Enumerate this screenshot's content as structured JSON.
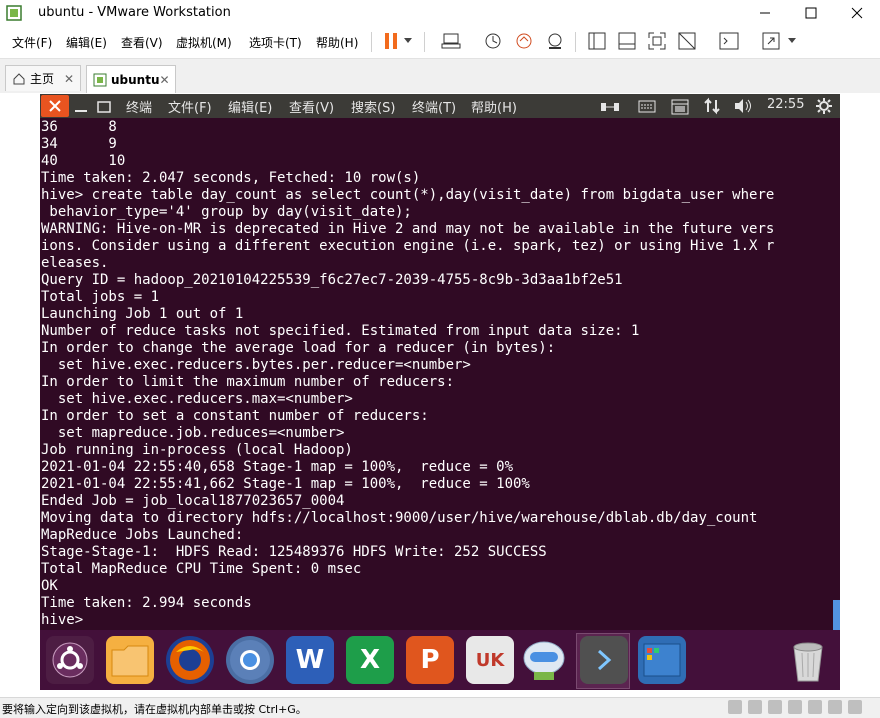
{
  "window": {
    "title": "ubuntu - VMware Workstation"
  },
  "menubar": {
    "items": [
      "文件(F)",
      "编辑(E)",
      "查看(V)",
      "虚拟机(M)",
      "选项卡(T)",
      "帮助(H)"
    ]
  },
  "tabs": [
    {
      "label": "主页",
      "icon": "home-icon",
      "active": false
    },
    {
      "label": "ubuntu",
      "icon": "vm-icon",
      "active": true
    }
  ],
  "ubuntu": {
    "menus": [
      "终端",
      "文件(F)",
      "编辑(E)",
      "查看(V)",
      "搜索(S)",
      "终端(T)",
      "帮助(H)"
    ],
    "clock": "22:55",
    "accent": "#e95420"
  },
  "terminal": {
    "lines": [
      "36      8",
      "34      9",
      "40      10",
      "Time taken: 2.047 seconds, Fetched: 10 row(s)",
      "hive> create table day_count as select count(*),day(visit_date) from bigdata_user where",
      " behavior_type='4' group by day(visit_date);",
      "WARNING: Hive-on-MR is deprecated in Hive 2 and may not be available in the future vers",
      "ions. Consider using a different execution engine (i.e. spark, tez) or using Hive 1.X r",
      "eleases.",
      "Query ID = hadoop_20210104225539_f6c27ec7-2039-4755-8c9b-3d3aa1bf2e51",
      "Total jobs = 1",
      "Launching Job 1 out of 1",
      "Number of reduce tasks not specified. Estimated from input data size: 1",
      "In order to change the average load for a reducer (in bytes):",
      "  set hive.exec.reducers.bytes.per.reducer=<number>",
      "In order to limit the maximum number of reducers:",
      "  set hive.exec.reducers.max=<number>",
      "In order to set a constant number of reducers:",
      "  set mapreduce.job.reduces=<number>",
      "Job running in-process (local Hadoop)",
      "2021-01-04 22:55:40,658 Stage-1 map = 100%,  reduce = 0%",
      "2021-01-04 22:55:41,662 Stage-1 map = 100%,  reduce = 100%",
      "Ended Job = job_local1877023657_0004",
      "Moving data to directory hdfs://localhost:9000/user/hive/warehouse/dblab.db/day_count",
      "MapReduce Jobs Launched:",
      "Stage-Stage-1:  HDFS Read: 125489376 HDFS Write: 252 SUCCESS",
      "Total MapReduce CPU Time Spent: 0 msec",
      "OK",
      "Time taken: 2.994 seconds",
      "hive> "
    ]
  },
  "dock": {
    "items": [
      {
        "name": "ubuntu-logo-icon"
      },
      {
        "name": "files-icon"
      },
      {
        "name": "firefox-icon"
      },
      {
        "name": "chromium-icon"
      },
      {
        "name": "wps-writer-icon",
        "label": "W"
      },
      {
        "name": "wps-spreadsheet-icon",
        "label": "X"
      },
      {
        "name": "wps-presentation-icon",
        "label": "P"
      },
      {
        "name": "software-center-icon",
        "label": "UK"
      },
      {
        "name": "installer-icon"
      },
      {
        "name": "terminal-icon"
      },
      {
        "name": "workspace-icon"
      },
      {
        "name": "trash-icon"
      }
    ]
  },
  "statusbar": {
    "text": "要将输入定向到该虚拟机，请在虚拟机内部单击或按 Ctrl+G。"
  }
}
